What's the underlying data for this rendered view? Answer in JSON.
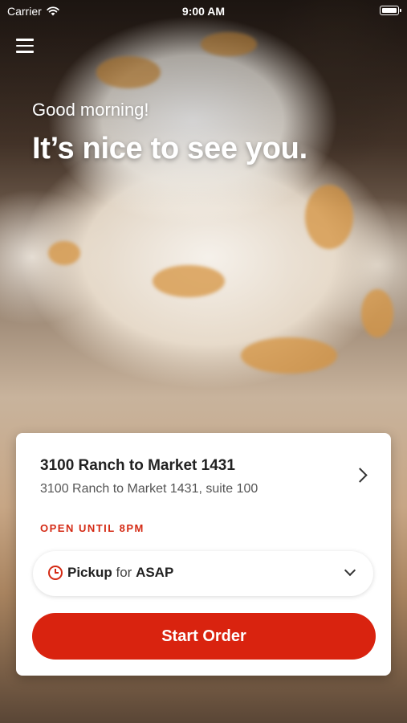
{
  "status_bar": {
    "carrier": "Carrier",
    "time": "9:00 AM"
  },
  "header": {
    "menu_icon": "hamburger-menu-icon",
    "greeting": "Good morning!",
    "headline": "It’s nice to see you."
  },
  "store_card": {
    "location_name": "3100 Ranch to Market 1431",
    "location_address": "3100 Ranch to Market 1431, suite 100",
    "hours": "OPEN UNTIL 8PM",
    "order_type": {
      "mode": "Pickup",
      "connector": "for",
      "time": "ASAP"
    },
    "start_button": "Start Order"
  },
  "colors": {
    "accent": "#d9230f",
    "hours_text": "#d42a14",
    "card_background": "#ffffff"
  }
}
